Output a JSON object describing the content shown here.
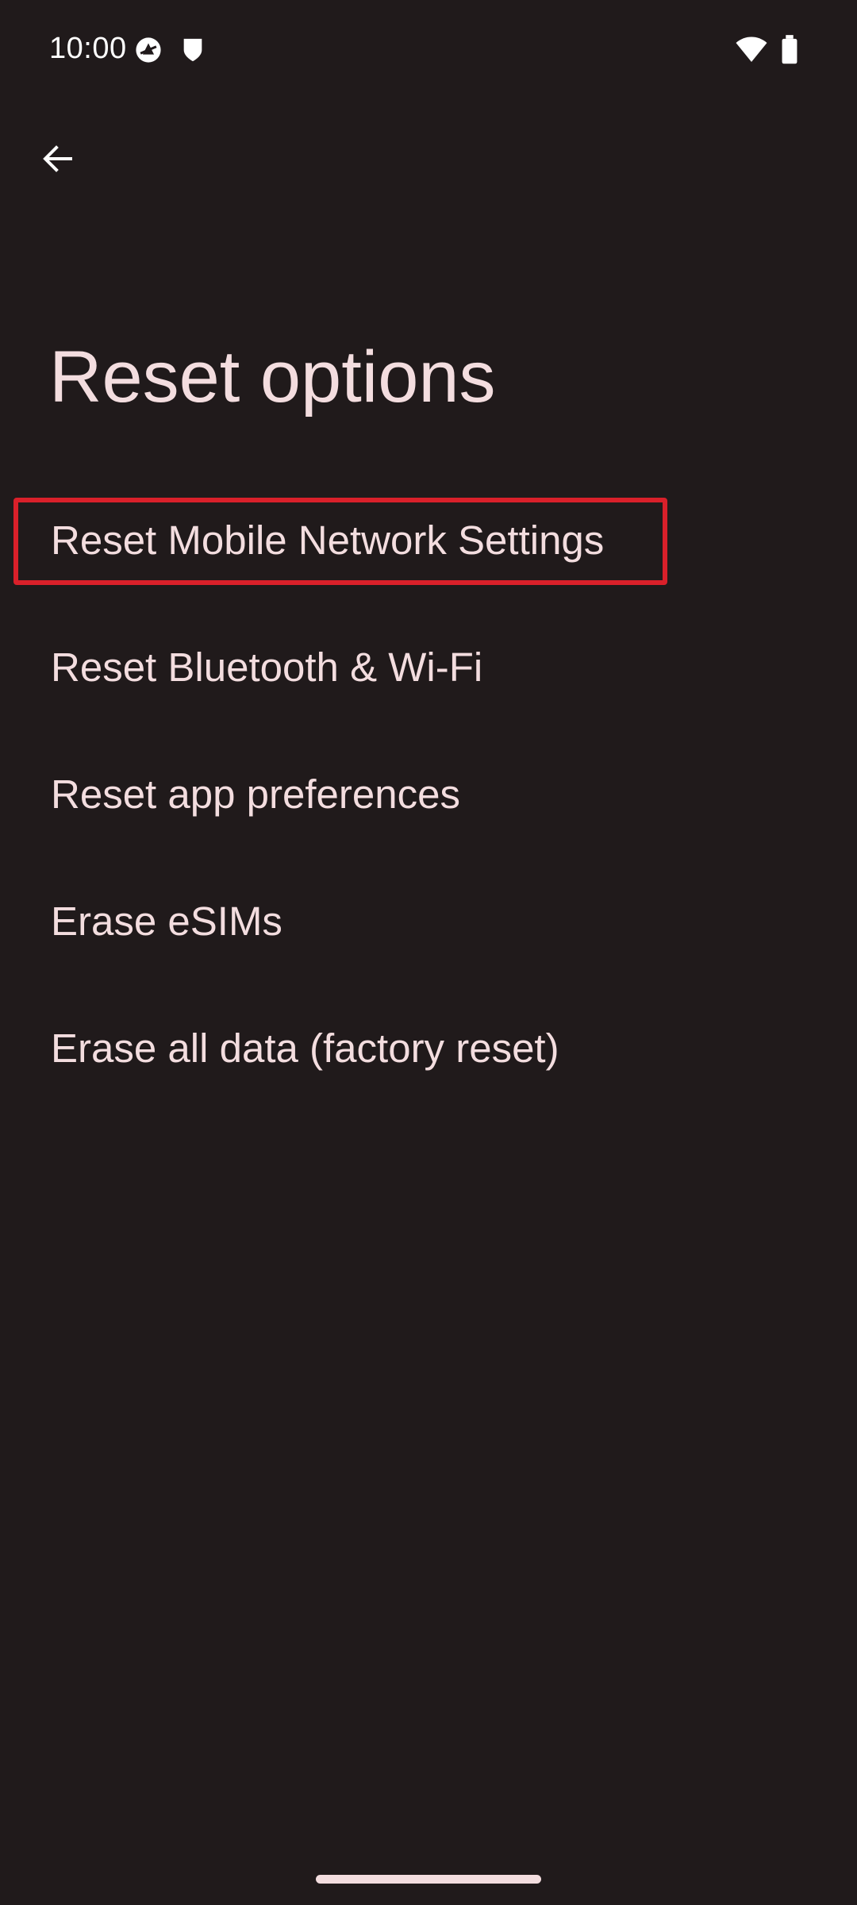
{
  "status_bar": {
    "time": "10:00",
    "icons": [
      "data-saver-icon",
      "shield-icon",
      "wifi-icon",
      "battery-icon"
    ]
  },
  "header": {
    "back_icon": "arrow-back-icon",
    "title": "Reset options"
  },
  "options": [
    {
      "label": "Reset Mobile Network Settings",
      "highlighted": true
    },
    {
      "label": "Reset Bluetooth & Wi-Fi",
      "highlighted": false
    },
    {
      "label": "Reset app preferences",
      "highlighted": false
    },
    {
      "label": "Erase eSIMs",
      "highlighted": false
    },
    {
      "label": "Erase all data (factory reset)",
      "highlighted": false
    }
  ],
  "colors": {
    "background": "#201a1b",
    "text": "#f3dddf",
    "highlight": "#d9202a"
  }
}
